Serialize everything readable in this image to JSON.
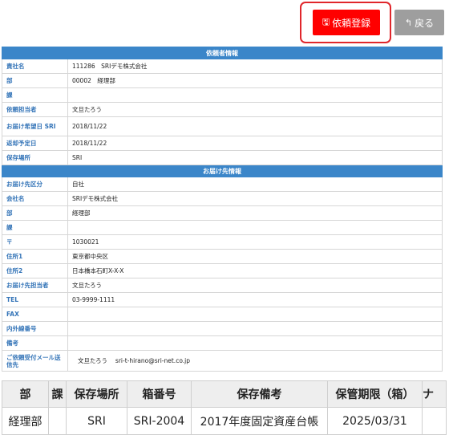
{
  "toolbar": {
    "register_label": "依頼登録",
    "register_icon": "save-icon",
    "back_label": "戻る",
    "back_icon": "reply-arrow-icon"
  },
  "requester": {
    "header": "依頼者情報",
    "rows": [
      {
        "label": "責社名",
        "value": "111286　SRIデモ株式会社"
      },
      {
        "label": "部",
        "value": "00002　経理部"
      },
      {
        "label": "課",
        "value": ""
      },
      {
        "label": "依頼担当者",
        "value": "文旦たろう"
      },
      {
        "label": "お届け希望日 SRI",
        "value": "2018/11/22"
      },
      {
        "label": "返却予定日",
        "value": "2018/11/22"
      },
      {
        "label": "保存場所",
        "value": "SRI"
      }
    ]
  },
  "delivery": {
    "header": "お届け先情報",
    "rows": [
      {
        "label": "お届け先区分",
        "value": "自社"
      },
      {
        "label": "会社名",
        "value": "SRIデモ株式会社"
      },
      {
        "label": "部",
        "value": "経理部"
      },
      {
        "label": "課",
        "value": ""
      },
      {
        "label": "〒",
        "value": "1030021"
      },
      {
        "label": "住所1",
        "value": "東京都中央区"
      },
      {
        "label": "住所2",
        "value": "日本橋本石町X-X-X"
      },
      {
        "label": "お届け先担当者",
        "value": "文旦たろう"
      },
      {
        "label": "TEL",
        "value": "03-9999-1111"
      },
      {
        "label": "FAX",
        "value": ""
      },
      {
        "label": "内外線番号",
        "value": ""
      },
      {
        "label": "備考",
        "value": ""
      },
      {
        "label": "ご依頼受付メール送信先",
        "value": "文旦たろう　 sri-t-hirano@sri-net.co.jp"
      }
    ]
  },
  "grid": {
    "headers": [
      "部",
      "課",
      "保存場所",
      "箱番号",
      "保存備考",
      "保管期限（箱）",
      "ナ"
    ],
    "rows": [
      [
        "経理部",
        "",
        "SRI",
        "SRI-2004",
        "2017年度固定資産台帳",
        "2025/03/31",
        ""
      ]
    ]
  },
  "colors": {
    "accent": "#ff0000",
    "section_header": "#3b86c9",
    "label_text": "#3575b8",
    "back_button": "#9e9e9e"
  }
}
